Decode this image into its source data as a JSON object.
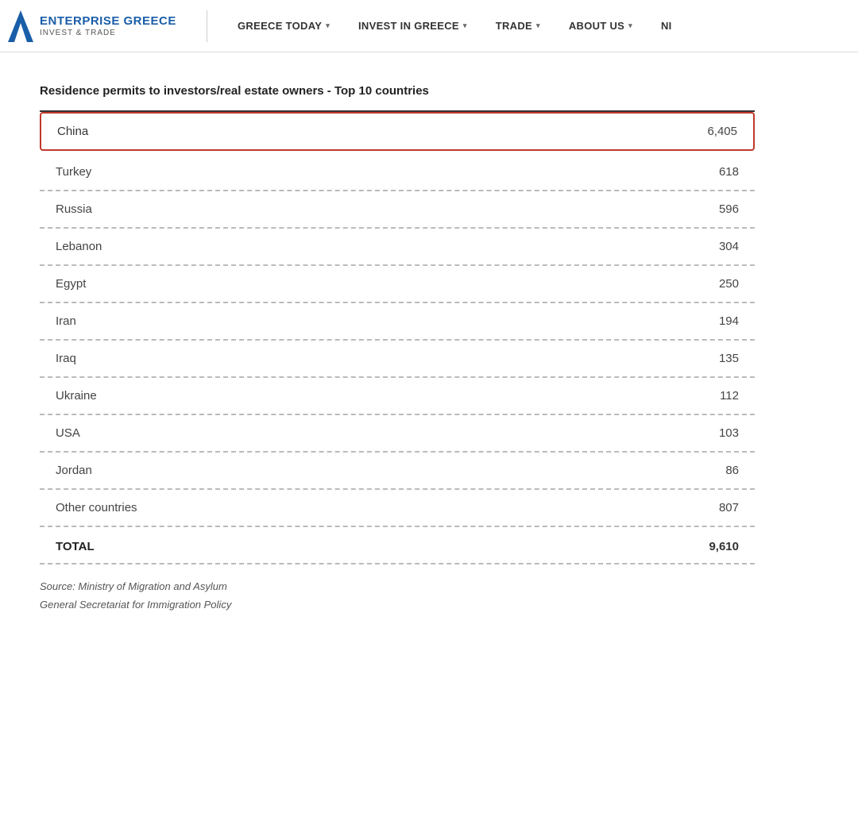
{
  "header": {
    "logo": {
      "line1": "ENTERPRISE GREECE",
      "line2": "INVEST & TRADE"
    },
    "nav": [
      {
        "label": "GREECE TODAY",
        "hasDropdown": true
      },
      {
        "label": "INVEST IN GREECE",
        "hasDropdown": true
      },
      {
        "label": "TRADE",
        "hasDropdown": true
      },
      {
        "label": "ABOUT US",
        "hasDropdown": true
      },
      {
        "label": "NI",
        "hasDropdown": false
      }
    ]
  },
  "chart": {
    "title": "Residence permits to investors/real estate owners - Top 10 countries",
    "highlighted": {
      "country": "China",
      "value": "6,405"
    },
    "rows": [
      {
        "country": "Turkey",
        "value": "618"
      },
      {
        "country": "Russia",
        "value": "596"
      },
      {
        "country": "Lebanon",
        "value": "304"
      },
      {
        "country": "Egypt",
        "value": "250"
      },
      {
        "country": "Iran",
        "value": "194"
      },
      {
        "country": "Iraq",
        "value": "135"
      },
      {
        "country": "Ukraine",
        "value": "112"
      },
      {
        "country": "USA",
        "value": "103"
      },
      {
        "country": "Jordan",
        "value": "86"
      },
      {
        "country": "Other countries",
        "value": "807"
      }
    ],
    "total": {
      "label": "TOTAL",
      "value": "9,610"
    },
    "sources": [
      "Source: Ministry of Migration and Asylum",
      "General Secretariat for Immigration Policy"
    ]
  },
  "colors": {
    "highlight_border": "#c0392b",
    "nav_text": "#333333",
    "logo_blue": "#1a5ea8"
  }
}
